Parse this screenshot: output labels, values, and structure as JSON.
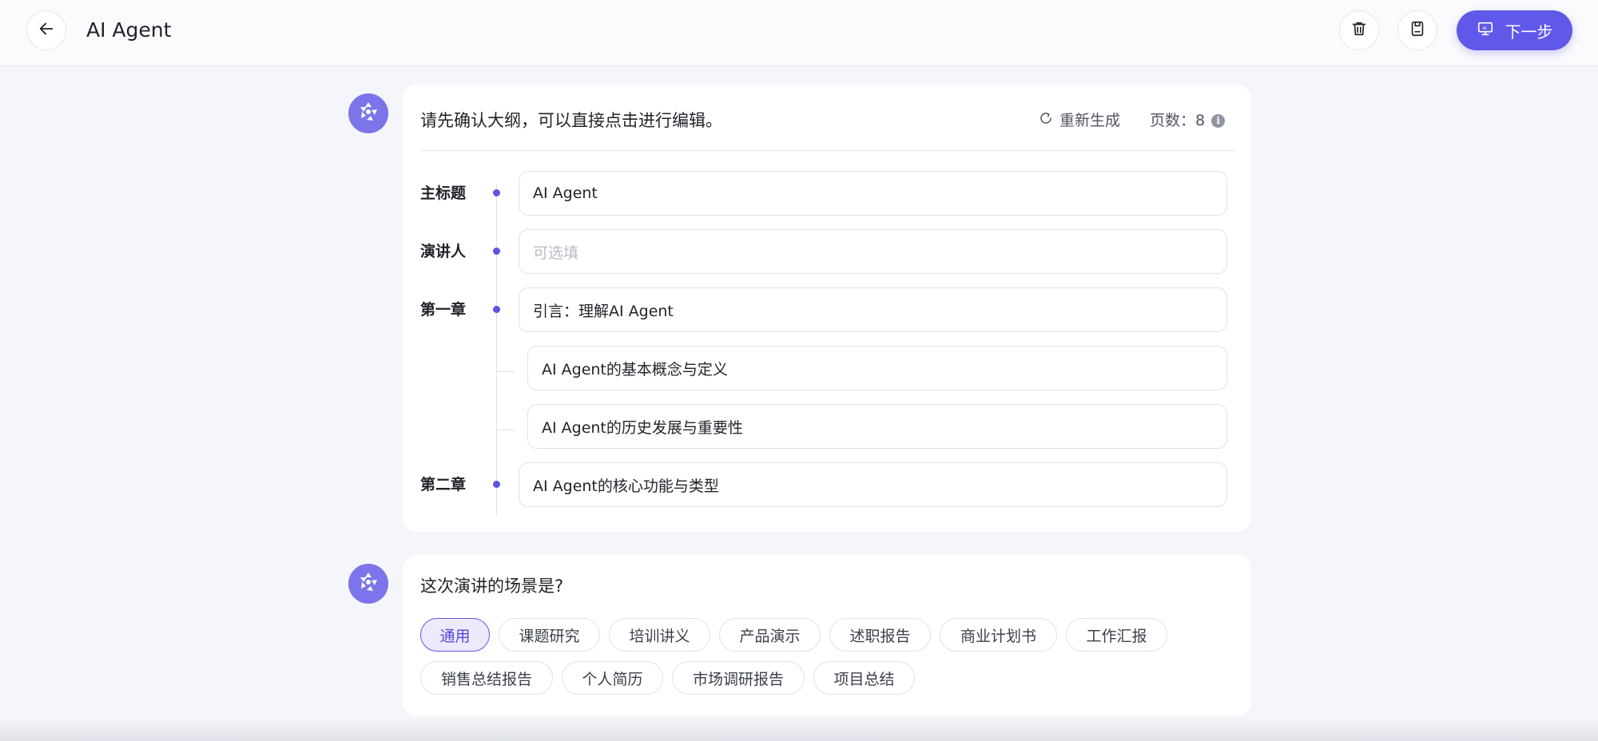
{
  "header": {
    "title": "AI Agent",
    "next_label": "下一步"
  },
  "outline": {
    "prompt": "请先确认大纲，可以直接点击进行编辑。",
    "regenerate_label": "重新生成",
    "pages_label": "页数：",
    "pages_value": "8",
    "info_glyph": "i",
    "rows": {
      "title_label": "主标题",
      "title_value": "AI Agent",
      "speaker_label": "演讲人",
      "speaker_placeholder": "可选填",
      "chapter1_label": "第一章",
      "chapter1_value": "引言：理解AI Agent",
      "chapter1_sub1": "AI Agent的基本概念与定义",
      "chapter1_sub2": "AI Agent的历史发展与重要性",
      "chapter2_label": "第二章",
      "chapter2_value": "AI Agent的核心功能与类型"
    }
  },
  "scene": {
    "question": "这次演讲的场景是?",
    "selected": "通用",
    "options": [
      "通用",
      "课题研究",
      "培训讲义",
      "产品演示",
      "述职报告",
      "商业计划书",
      "工作汇报",
      "销售总结报告",
      "个人简历",
      "市场调研报告",
      "项目总结"
    ]
  },
  "icons": {
    "back": "arrow-left-icon",
    "trash": "trash-icon",
    "save": "save-icon",
    "presentation": "ai-presentation-icon",
    "avatar": "assistant-logo-icon",
    "refresh": "refresh-icon",
    "info": "info-icon"
  },
  "colors": {
    "accent": "#6058e8",
    "avatar": "#7b74ea",
    "background": "#f5f6fb"
  }
}
